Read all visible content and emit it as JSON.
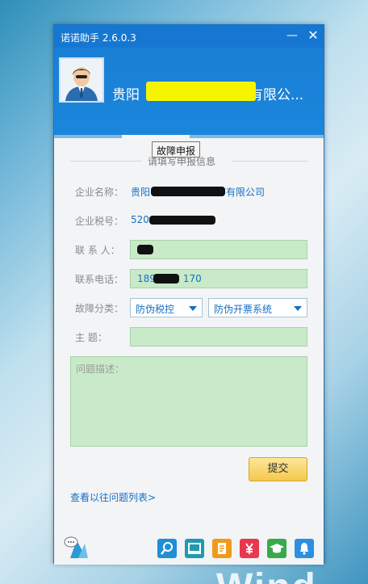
{
  "window": {
    "title": "诺诺助手 2.6.0.3",
    "minimize_glyph": "—",
    "close_glyph": "✕"
  },
  "profile": {
    "company_name": "贵阳",
    "company_name_suffix": "有限公..."
  },
  "tabs": [
    {
      "icon": "globe-icon",
      "active": false
    },
    {
      "icon": "report-form-icon",
      "active": true,
      "tooltip": "故障申报"
    },
    {
      "icon": "calendar-icon",
      "active": false
    },
    {
      "icon": "grid-apps-icon",
      "active": false
    }
  ],
  "form": {
    "section_title": "请填写申报信息",
    "company_label": "企业名称：",
    "company_value_prefix": "贵阳",
    "company_value_suffix": "有限公司",
    "tax_label": "企业税号：",
    "tax_value_prefix": "520",
    "contact_label": "联  系  人：",
    "contact_value": "",
    "phone_label": "联系电话：",
    "phone_value_prefix": "189",
    "phone_value_suffix": "170",
    "category_label": "故障分类：",
    "category_primary": "防伪税控",
    "category_secondary": "防伪开票系统",
    "subject_label": "主      题：",
    "subject_value": "",
    "description_placeholder": "问题描述：",
    "submit_label": "提交",
    "history_link": "查看以往问题列表>"
  },
  "bottom_icons": [
    {
      "name": "chat-icon",
      "color": "#2a9ad6"
    },
    {
      "name": "search-icon",
      "color": "#1f8fd6"
    },
    {
      "name": "computer-icon",
      "color": "#1f9ab0"
    },
    {
      "name": "document-icon",
      "color": "#f09a1c"
    },
    {
      "name": "yuan-icon",
      "color": "#e8384f"
    },
    {
      "name": "graduation-icon",
      "color": "#3aa94a"
    },
    {
      "name": "bell-icon",
      "color": "#2e8fe0"
    }
  ],
  "desktop": {
    "watermark_text": "Wind"
  }
}
